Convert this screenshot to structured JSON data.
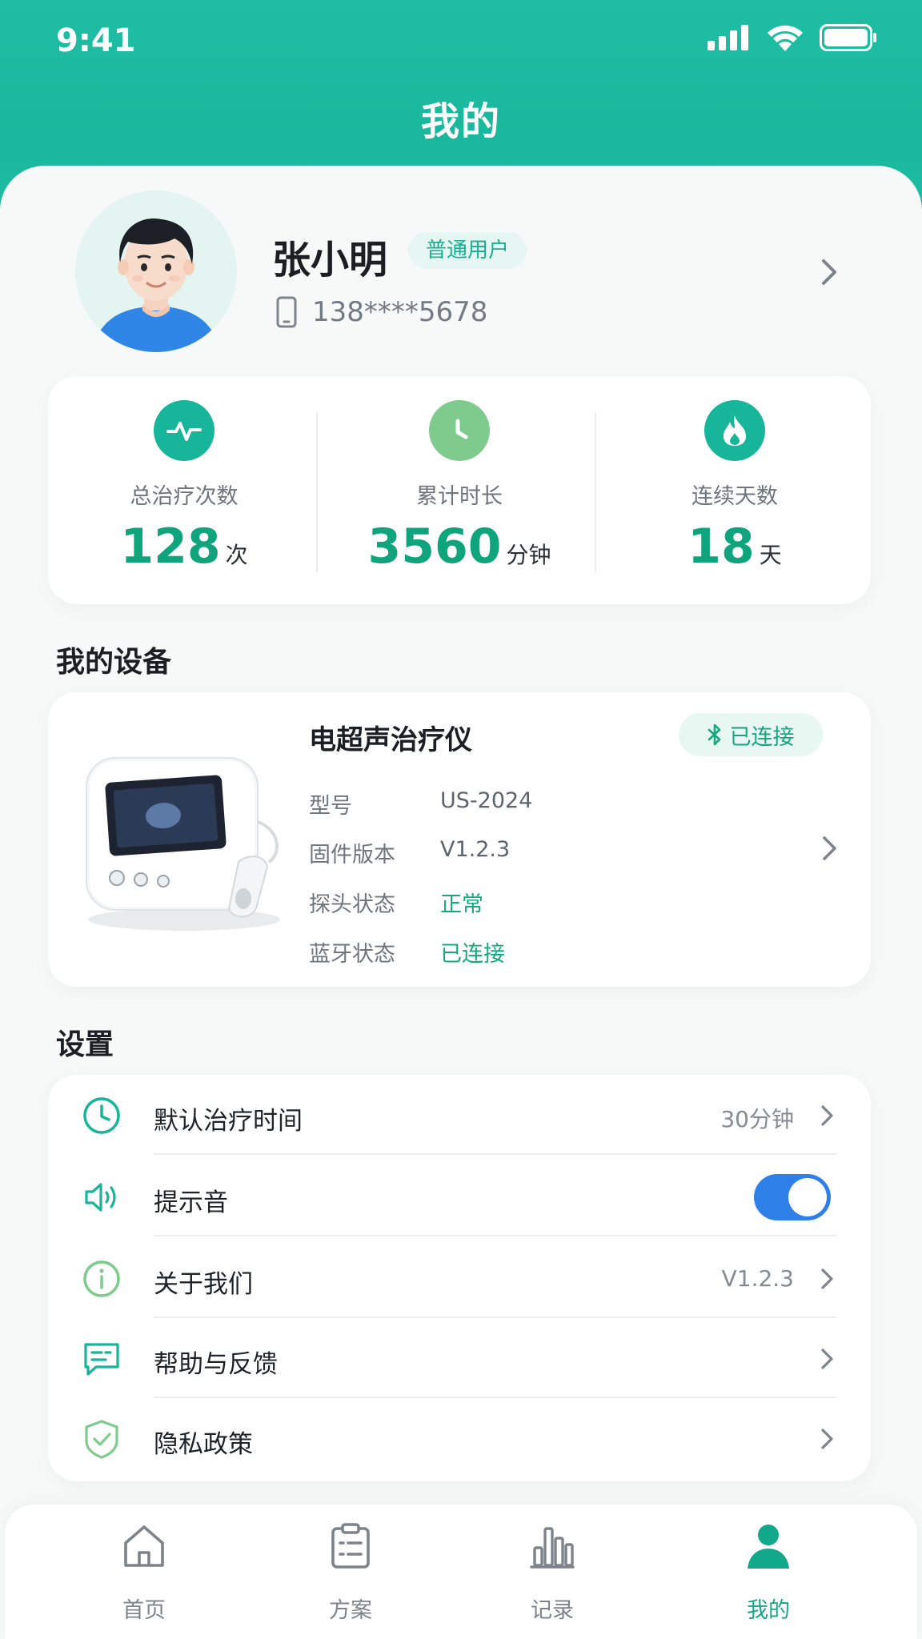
{
  "status_bar": {
    "time": "9:41"
  },
  "header": {
    "title": "我的"
  },
  "profile": {
    "name": "张小明",
    "badge": "普通用户",
    "phone": "138****5678"
  },
  "stats": [
    {
      "label": "总治疗次数",
      "value": "128",
      "unit": "次",
      "icon": "activity-icon",
      "color": "#17b59a"
    },
    {
      "label": "累计时长",
      "value": "3560",
      "unit": "分钟",
      "icon": "clock-icon",
      "color": "#7fcb8e"
    },
    {
      "label": "连续天数",
      "value": "18",
      "unit": "天",
      "icon": "flame-icon",
      "color": "#17b59a"
    }
  ],
  "device_section": {
    "title": "我的设备",
    "device": {
      "name": "电超声治疗仪",
      "connection": "已连接",
      "rows": [
        {
          "key": "型号",
          "value": "US-2024"
        },
        {
          "key": "固件版本",
          "value": "V1.2.3"
        },
        {
          "key": "探头状态",
          "value": "正常"
        },
        {
          "key": "蓝牙状态",
          "value": "已连接"
        }
      ]
    }
  },
  "settings_section": {
    "title": "设置",
    "items": [
      {
        "label": "默认治疗时间",
        "value": "30分钟",
        "icon": "clock-outline-icon"
      },
      {
        "label": "提示音",
        "value": "",
        "icon": "speaker-icon",
        "toggle_on": true
      },
      {
        "label": "关于我们",
        "value": "V1.2.3",
        "icon": "info-icon"
      },
      {
        "label": "帮助与反馈",
        "value": "",
        "icon": "feedback-icon"
      },
      {
        "label": "隐私政策",
        "value": "",
        "icon": "shield-check-icon"
      }
    ]
  },
  "tabbar": {
    "tabs": [
      {
        "label": "首页",
        "icon": "home-icon"
      },
      {
        "label": "方案",
        "icon": "clipboard-icon"
      },
      {
        "label": "记录",
        "icon": "bar-chart-icon"
      },
      {
        "label": "我的",
        "icon": "user-icon",
        "active": true
      }
    ]
  },
  "colors": {
    "primary": "#1fbea4",
    "accent_green": "#10a47c",
    "toggle_blue": "#2f7fe8"
  }
}
